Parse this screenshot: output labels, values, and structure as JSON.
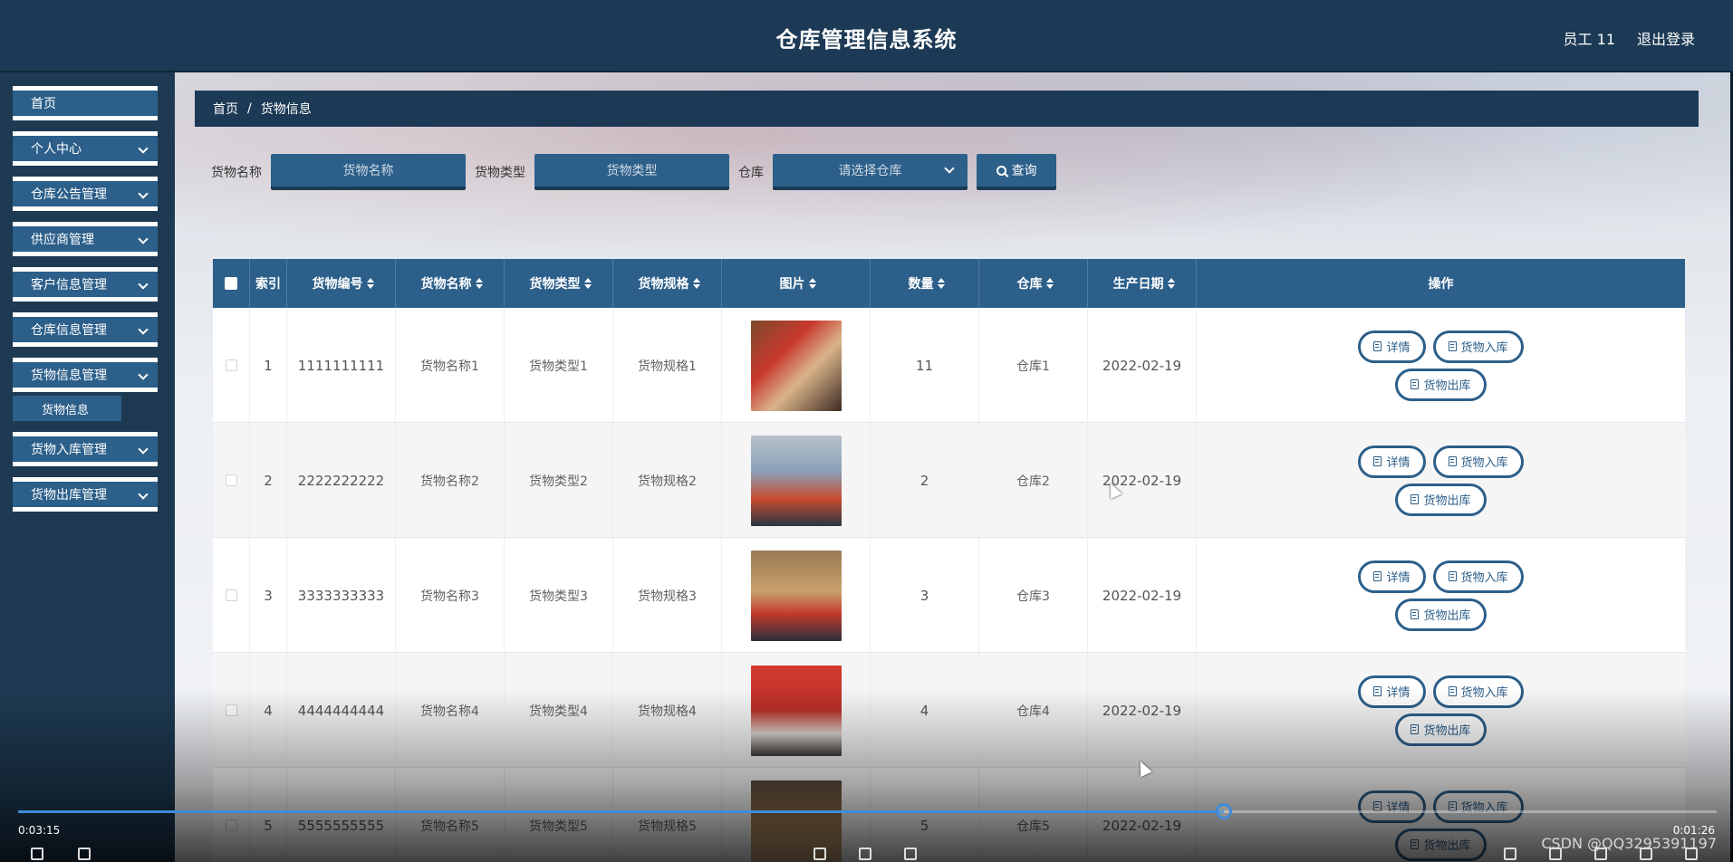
{
  "app": {
    "title": "仓库管理信息系统",
    "user": "员工 11",
    "logout": "退出登录"
  },
  "sidebar": {
    "items": [
      {
        "label": "首页"
      },
      {
        "label": "个人中心"
      },
      {
        "label": "仓库公告管理"
      },
      {
        "label": "供应商管理"
      },
      {
        "label": "客户信息管理"
      },
      {
        "label": "仓库信息管理"
      },
      {
        "label": "货物信息管理"
      },
      {
        "label": "货物入库管理"
      },
      {
        "label": "货物出库管理"
      }
    ],
    "submenu": {
      "label": "货物信息"
    }
  },
  "breadcrumb": {
    "home": "首页",
    "sep": "/",
    "current": "货物信息"
  },
  "search": {
    "name_label": "货物名称",
    "name_placeholder": "货物名称",
    "type_label": "货物类型",
    "type_placeholder": "货物类型",
    "warehouse_label": "仓库",
    "warehouse_placeholder": "请选择仓库",
    "query_label": "查询"
  },
  "table": {
    "headers": [
      "索引",
      "货物编号",
      "货物名称",
      "货物类型",
      "货物规格",
      "图片",
      "数量",
      "仓库",
      "生产日期",
      "操作"
    ],
    "rows": [
      {
        "index": "1",
        "code": "1111111111",
        "name": "货物名称1",
        "type": "货物类型1",
        "spec": "货物规格1",
        "qty": "11",
        "warehouse": "仓库1",
        "date": "2022-02-19"
      },
      {
        "index": "2",
        "code": "2222222222",
        "name": "货物名称2",
        "type": "货物类型2",
        "spec": "货物规格2",
        "qty": "2",
        "warehouse": "仓库2",
        "date": "2022-02-19"
      },
      {
        "index": "3",
        "code": "3333333333",
        "name": "货物名称3",
        "type": "货物类型3",
        "spec": "货物规格3",
        "qty": "3",
        "warehouse": "仓库3",
        "date": "2022-02-19"
      },
      {
        "index": "4",
        "code": "4444444444",
        "name": "货物名称4",
        "type": "货物类型4",
        "spec": "货物规格4",
        "qty": "4",
        "warehouse": "仓库4",
        "date": "2022-02-19"
      },
      {
        "index": "5",
        "code": "5555555555",
        "name": "货物名称5",
        "type": "货物类型5",
        "spec": "货物规格5",
        "qty": "5",
        "warehouse": "仓库5",
        "date": "2022-02-19"
      }
    ],
    "actions": {
      "detail": "详情",
      "in": "货物入库",
      "out": "货物出库"
    }
  },
  "player": {
    "elapsed": "0:03:15",
    "remaining": "0:01:26",
    "progress": 0.71,
    "watermark": "CSDN @QQ3295391197"
  },
  "colors": {
    "header": "#1c3a55",
    "accent": "#2c5f8a",
    "progress": "#3f8bd8"
  }
}
